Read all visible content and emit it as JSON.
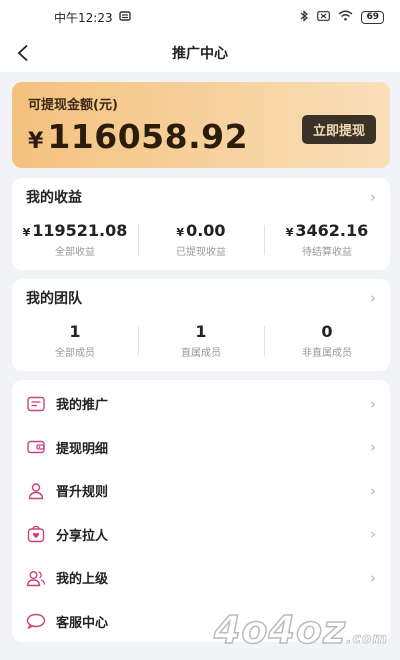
{
  "status_bar": {
    "time": "中午12:23",
    "battery": "69"
  },
  "nav": {
    "title": "推广中心"
  },
  "balance": {
    "label": "可提现金额(元)",
    "currency": "¥",
    "amount": "116058.92",
    "withdraw_label": "立即提现"
  },
  "earnings": {
    "title": "我的收益",
    "stats": [
      {
        "currency": "¥",
        "value": "119521.08",
        "label": "全部收益"
      },
      {
        "currency": "¥",
        "value": "0.00",
        "label": "已提现收益"
      },
      {
        "currency": "¥",
        "value": "3462.16",
        "label": "待结算收益"
      }
    ]
  },
  "team": {
    "title": "我的团队",
    "stats": [
      {
        "value": "1",
        "label": "全部成员"
      },
      {
        "value": "1",
        "label": "直属成员"
      },
      {
        "value": "0",
        "label": "非直属成员"
      }
    ]
  },
  "menu": [
    {
      "label": "我的推广",
      "icon": "promotion-icon"
    },
    {
      "label": "提现明细",
      "icon": "wallet-icon"
    },
    {
      "label": "晋升规则",
      "icon": "person-icon"
    },
    {
      "label": "分享拉人",
      "icon": "heart-bag-icon"
    },
    {
      "label": "我的上级",
      "icon": "users-icon"
    },
    {
      "label": "客服中心",
      "icon": "chat-icon"
    }
  ],
  "accent_color": "#c8447a",
  "watermark": {
    "text": "4o4oz",
    "suffix": ".com"
  }
}
